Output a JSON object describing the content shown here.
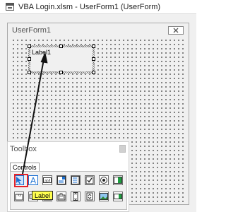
{
  "window": {
    "title": "VBA Login.xlsm - UserForm1 (UserForm)"
  },
  "userform": {
    "title": "UserForm1",
    "label_control": {
      "caption": "Label1"
    }
  },
  "toolbox": {
    "title": "Toolbox",
    "tab": "Controls",
    "tooltip": "Label",
    "tools_row1": [
      "select-objects",
      "label",
      "textbox",
      "combobox",
      "listbox",
      "checkbox",
      "optionbutton",
      "togglebutton"
    ],
    "tools_row2": [
      "frame",
      "commandbutton",
      "tabstrip",
      "multipage",
      "scrollbar",
      "spinbutton",
      "image",
      "refedit"
    ]
  },
  "colors": {
    "highlight": "#e3232a",
    "tooltip_bg": "#ffff4f",
    "accent_blue": "#1a6fd1"
  }
}
